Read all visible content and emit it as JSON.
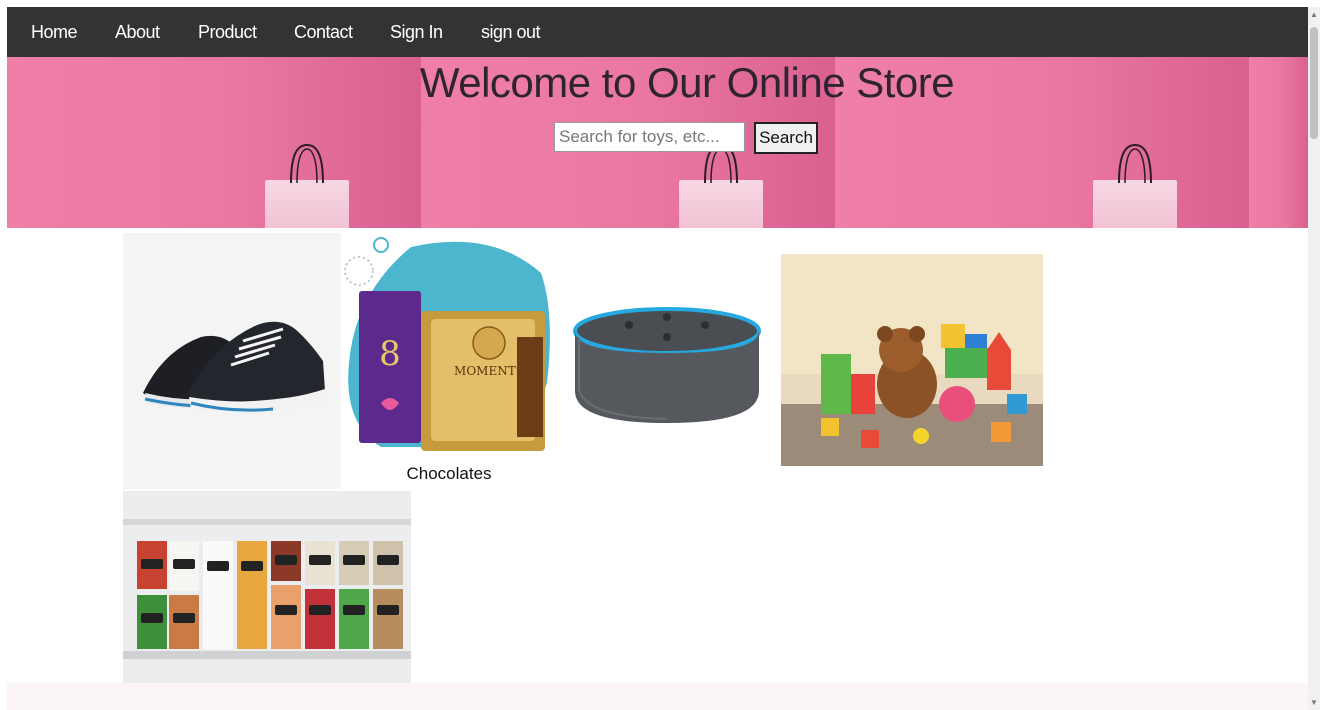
{
  "nav": {
    "items": [
      {
        "label": "Home"
      },
      {
        "label": "About"
      },
      {
        "label": "Product"
      },
      {
        "label": "Contact"
      },
      {
        "label": "Sign In"
      },
      {
        "label": "sign out"
      }
    ]
  },
  "hero": {
    "title": "Welcome to Our Online Store",
    "search_placeholder": "Search for toys, etc...",
    "search_value": "",
    "search_button": "Search"
  },
  "products": {
    "chocolates_caption": "Chocolates"
  },
  "colors": {
    "nav_bg": "#333333",
    "hero_pink": "#ea77a2",
    "smart_speaker_ring": "#25a9e0"
  }
}
